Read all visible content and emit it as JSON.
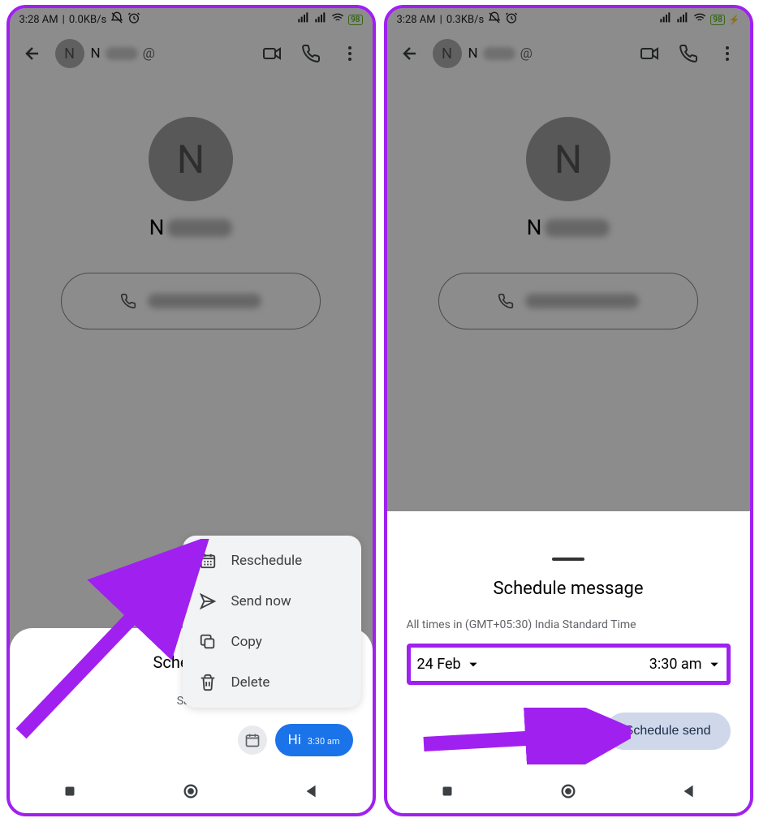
{
  "leftScreen": {
    "status": {
      "time": "3:28 AM",
      "netspeed": "0.0KB/s",
      "battery": "98"
    },
    "header": {
      "avatar_letter": "N",
      "name": "N"
    },
    "contact": {
      "avatar_letter": "N",
      "name": "N"
    },
    "scheduled_panel": {
      "title_visible": "Scheduled",
      "date_visible": "Sat, 2",
      "message": {
        "text": "Hi",
        "time": "3:30 am"
      }
    },
    "menu": {
      "items": [
        {
          "label": "Reschedule",
          "icon": "calendar"
        },
        {
          "label": "Send now",
          "icon": "send"
        },
        {
          "label": "Copy",
          "icon": "copy"
        },
        {
          "label": "Delete",
          "icon": "trash"
        }
      ]
    }
  },
  "rightScreen": {
    "status": {
      "time": "3:28 AM",
      "netspeed": "0.3KB/s",
      "battery": "98"
    },
    "header": {
      "avatar_letter": "N",
      "name": "N"
    },
    "contact": {
      "avatar_letter": "N",
      "name": "N"
    },
    "sheet": {
      "title": "Schedule message",
      "tz_note": "All times in (GMT+05:30) India Standard Time",
      "date": "24 Feb",
      "time": "3:30 am",
      "button": "Schedule send"
    }
  }
}
